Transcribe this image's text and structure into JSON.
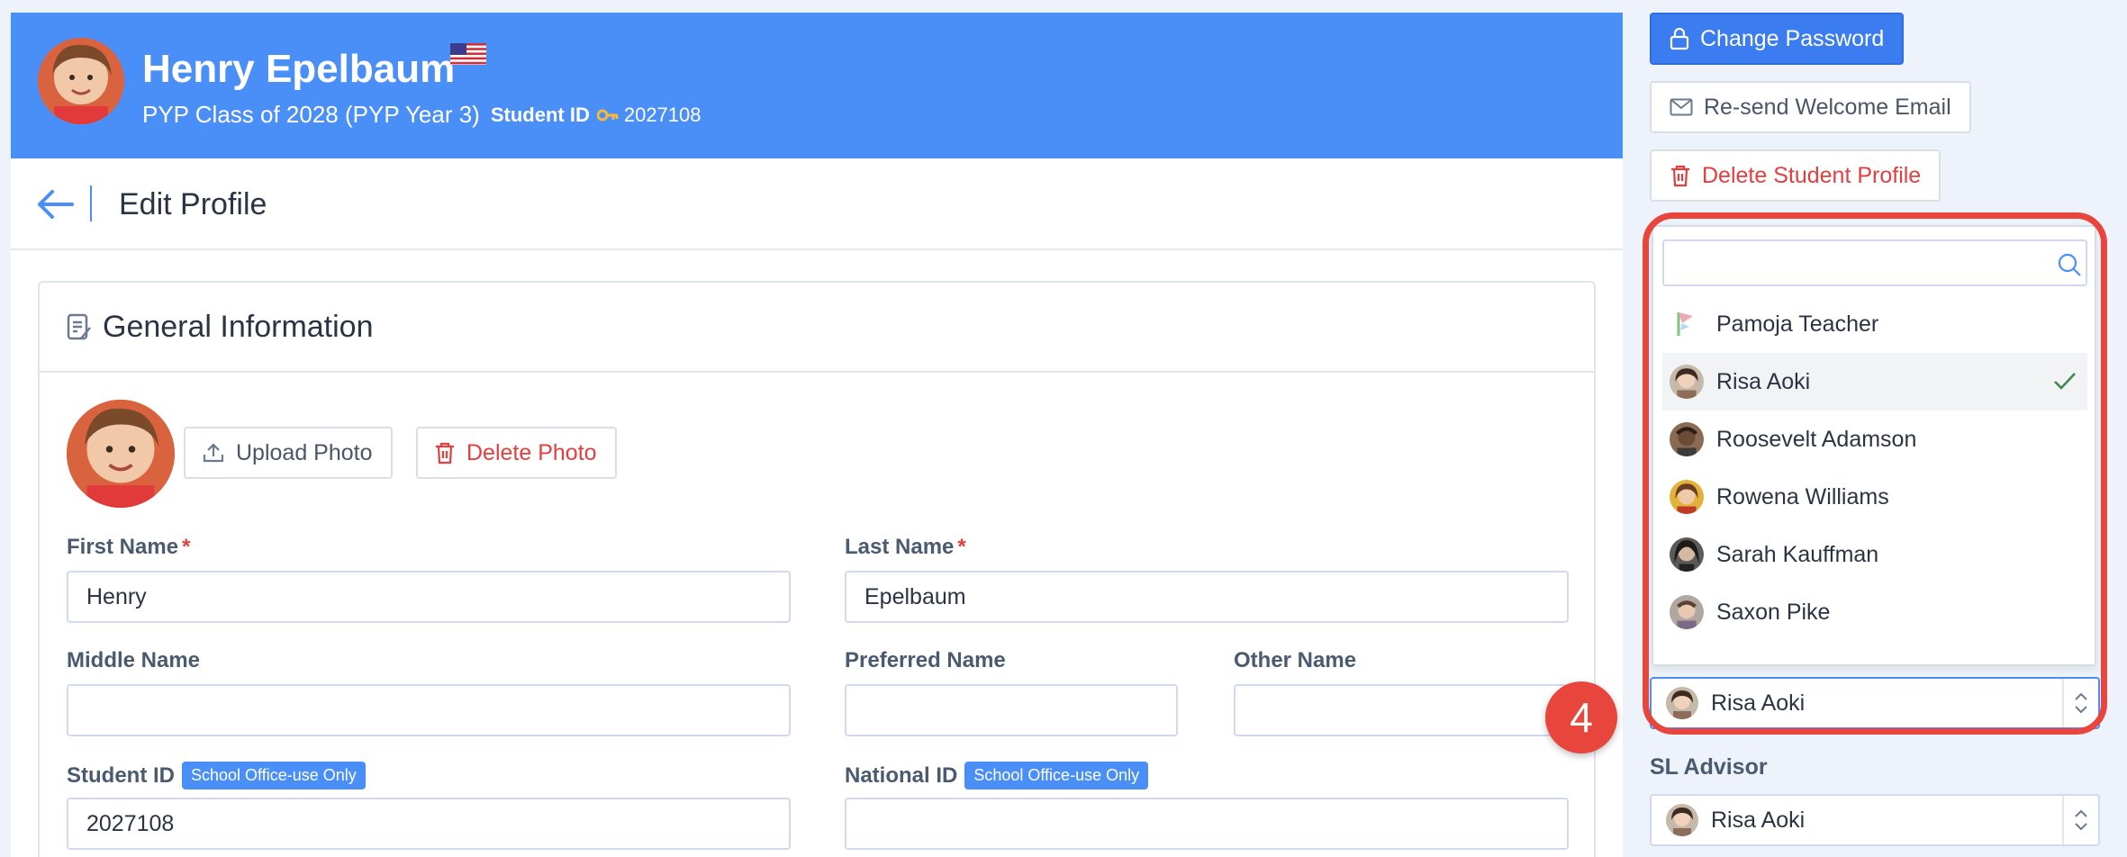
{
  "student": {
    "name": "Henry Epelbaum",
    "class": "PYP Class of 2028 (PYP Year 3)",
    "student_id_label": "Student ID",
    "student_id": "2027108"
  },
  "edit_bar": {
    "title": "Edit Profile"
  },
  "general_info": {
    "title": "General Information",
    "upload_photo": "Upload Photo",
    "delete_photo": "Delete Photo",
    "first_name_label": "First Name",
    "first_name": "Henry",
    "last_name_label": "Last Name",
    "last_name": "Epelbaum",
    "middle_name_label": "Middle Name",
    "middle_name": "",
    "preferred_name_label": "Preferred Name",
    "preferred_name": "",
    "other_name_label": "Other Name",
    "other_name": "",
    "student_id_label": "Student ID",
    "national_id_label": "National ID",
    "office_badge": "School Office-use Only",
    "student_id": "2027108",
    "national_id": "",
    "required_mark": "*"
  },
  "sidebar": {
    "change_password": "Change Password",
    "resend_email": "Re-send Welcome Email",
    "delete_student": "Delete Student Profile",
    "advisor_selected": "Risa Aoki",
    "sl_advisor_label": "SL Advisor",
    "sl_advisor_selected": "Risa Aoki"
  },
  "dropdown": {
    "search_value": "",
    "items": [
      {
        "label": "Pamoja Teacher"
      },
      {
        "label": "Risa Aoki"
      },
      {
        "label": "Roosevelt Adamson"
      },
      {
        "label": "Rowena Williams"
      },
      {
        "label": "Sarah Kauffman"
      },
      {
        "label": "Saxon Pike"
      }
    ]
  },
  "annotation": {
    "step": "4"
  },
  "colors": {
    "primary": "#4a8ff8",
    "danger": "#e53e3e",
    "highlight": "#e8453c"
  }
}
